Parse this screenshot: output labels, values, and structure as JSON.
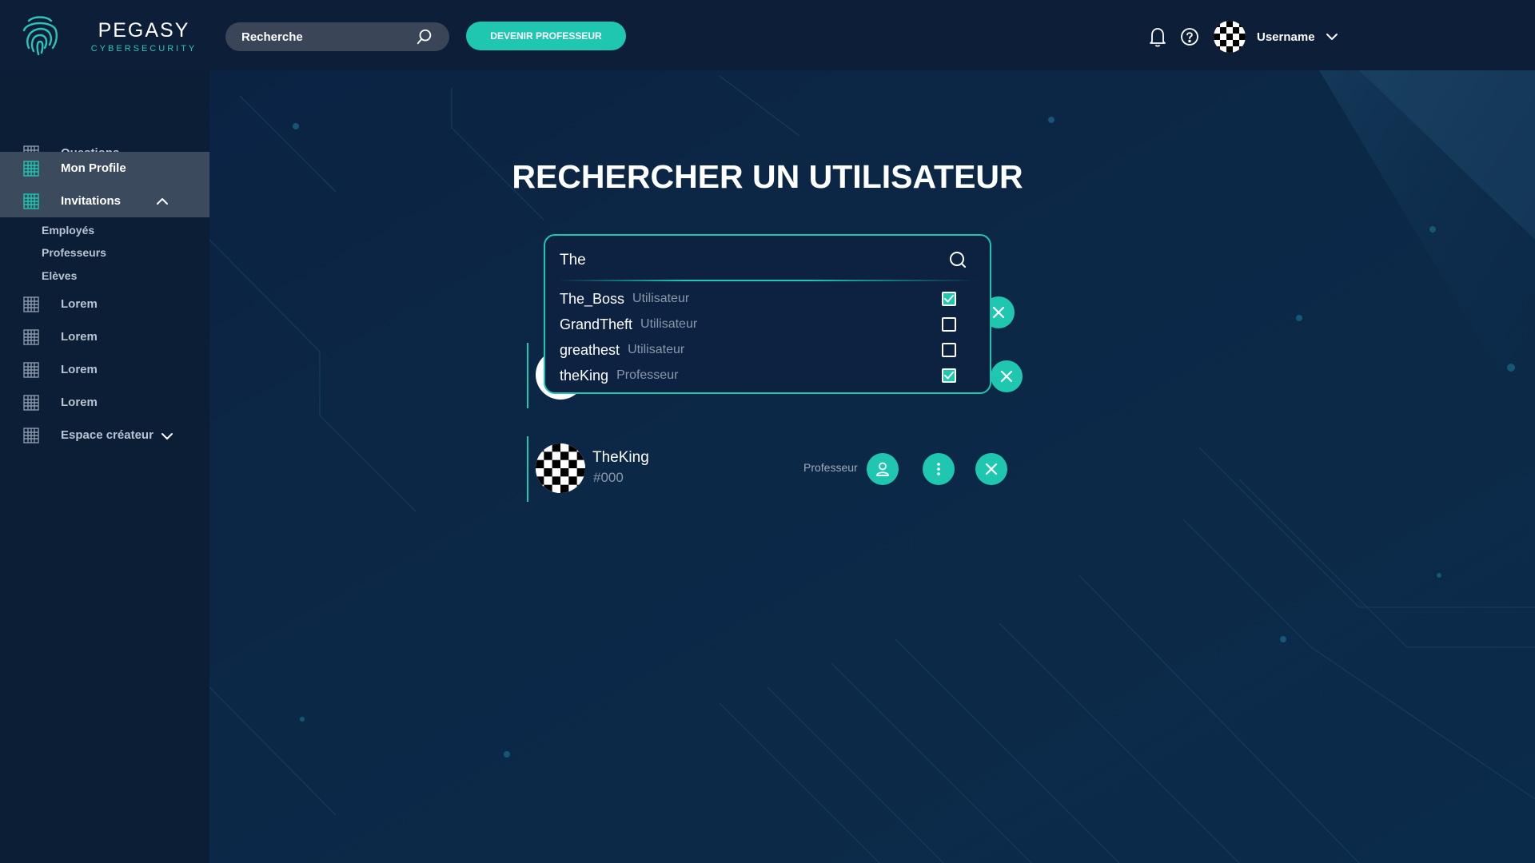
{
  "brand": {
    "name": "PEGASY",
    "tagline": "CYBERSECURITY"
  },
  "topbar": {
    "search_placeholder": "Recherche",
    "become_teacher_label": "DEVENIR PROFESSEUR",
    "username": "Username"
  },
  "sidebar": {
    "items": [
      {
        "label": "Questions"
      },
      {
        "label": "Mon Profile"
      },
      {
        "label": "Invitations"
      },
      {
        "label": "Lorem"
      },
      {
        "label": "Lorem"
      },
      {
        "label": "Lorem"
      },
      {
        "label": "Lorem"
      },
      {
        "label": "Espace créateur"
      }
    ],
    "invitations_sub": [
      "Employés",
      "Professeurs",
      "Elèves"
    ]
  },
  "main": {
    "title": "RECHERCHER UN UTILISATEUR",
    "search_value": "The",
    "results": [
      {
        "name": "The_Boss",
        "type": "Utilisateur",
        "checked": true
      },
      {
        "name": "GrandTheft",
        "type": "Utilisateur",
        "checked": false
      },
      {
        "name": "greathest",
        "type": "Utilisateur",
        "checked": false
      },
      {
        "name": "theKing",
        "type": "Professeur",
        "checked": true
      }
    ],
    "cards": [
      {
        "name": "TheKing",
        "tag": "#000",
        "role": "Professeur"
      }
    ]
  },
  "colors": {
    "accent": "#1fc7b1",
    "background": "#0c2341",
    "sidebar": "#0c1e36",
    "sidebar_active": "#3c4a5e"
  }
}
